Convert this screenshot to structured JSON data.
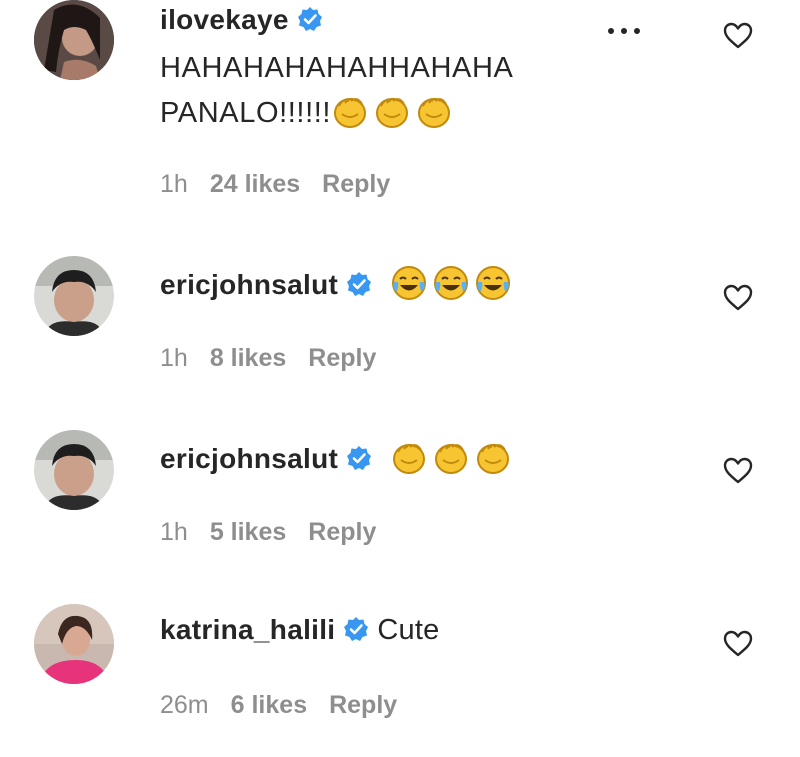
{
  "comments": [
    {
      "username": "ilovekaye",
      "text_lines": [
        "HAHAHAHAHAHHAHAHA",
        "PANALO!!!!!!"
      ],
      "emojis": [
        "clapping-hands",
        "clapping-hands",
        "clapping-hands"
      ],
      "time": "1h",
      "likes": "24 likes",
      "reply": "Reply"
    },
    {
      "username": "ericjohnsalut",
      "text": "",
      "emojis": [
        "face-with-tears-of-joy",
        "face-with-tears-of-joy",
        "face-with-tears-of-joy"
      ],
      "time": "1h",
      "likes": "8 likes",
      "reply": "Reply"
    },
    {
      "username": "ericjohnsalut",
      "text": "",
      "emojis": [
        "clapping-hands",
        "clapping-hands",
        "clapping-hands"
      ],
      "time": "1h",
      "likes": "5 likes",
      "reply": "Reply"
    },
    {
      "username": "katrina_halili",
      "text": "Cute",
      "emojis": [],
      "time": "26m",
      "likes": "6 likes",
      "reply": "Reply"
    }
  ],
  "icons": {
    "verified": "verified-badge-icon",
    "like": "heart-outline-icon",
    "more": "more-options-icon"
  },
  "colors": {
    "verified_blue": "#3897f0",
    "meta_gray": "#8e8e8e",
    "text": "#262626",
    "clap_yellow": "#f7c531"
  }
}
